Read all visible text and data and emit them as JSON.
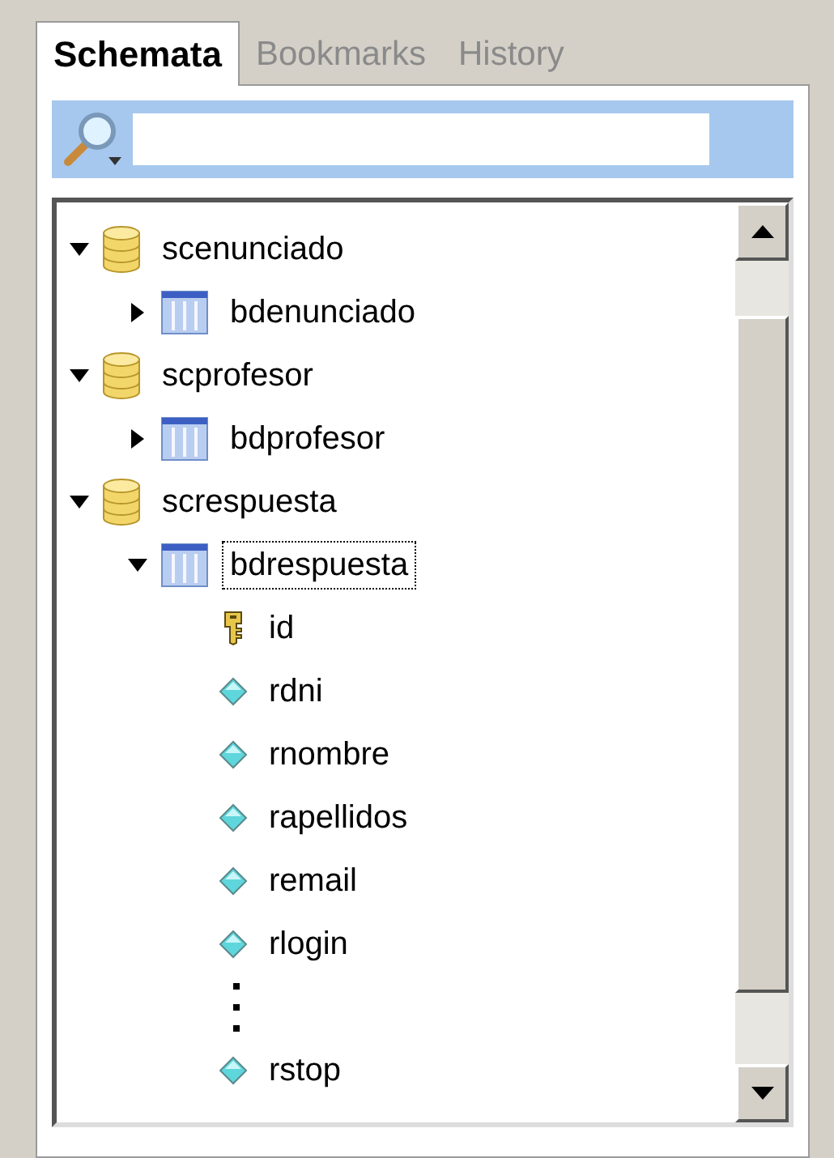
{
  "tabs": [
    {
      "label": "Schemata",
      "selected": true
    },
    {
      "label": "Bookmarks",
      "selected": false
    },
    {
      "label": "History",
      "selected": false
    }
  ],
  "tree": [
    {
      "kind": "schema",
      "label": "scenunciado",
      "expanded": true,
      "selected": false,
      "children": [
        {
          "kind": "table",
          "label": "bdenunciado",
          "expanded": false,
          "selected": false
        }
      ]
    },
    {
      "kind": "schema",
      "label": "scprofesor",
      "expanded": true,
      "selected": false,
      "children": [
        {
          "kind": "table",
          "label": "bdprofesor",
          "expanded": false,
          "selected": false
        }
      ]
    },
    {
      "kind": "schema",
      "label": "screspuesta",
      "expanded": true,
      "selected": false,
      "children": [
        {
          "kind": "table",
          "label": "bdrespuesta",
          "expanded": true,
          "selected": true,
          "children": [
            {
              "kind": "key",
              "label": "id",
              "selected": false
            },
            {
              "kind": "column",
              "label": "rdni",
              "selected": false
            },
            {
              "kind": "column",
              "label": "rnombre",
              "selected": false
            },
            {
              "kind": "column",
              "label": "rapellidos",
              "selected": false
            },
            {
              "kind": "column",
              "label": "remail",
              "selected": false
            },
            {
              "kind": "column",
              "label": "rlogin",
              "selected": false
            },
            {
              "kind": "ellipsis"
            },
            {
              "kind": "column",
              "label": "rstop",
              "selected": false
            }
          ]
        }
      ]
    }
  ]
}
